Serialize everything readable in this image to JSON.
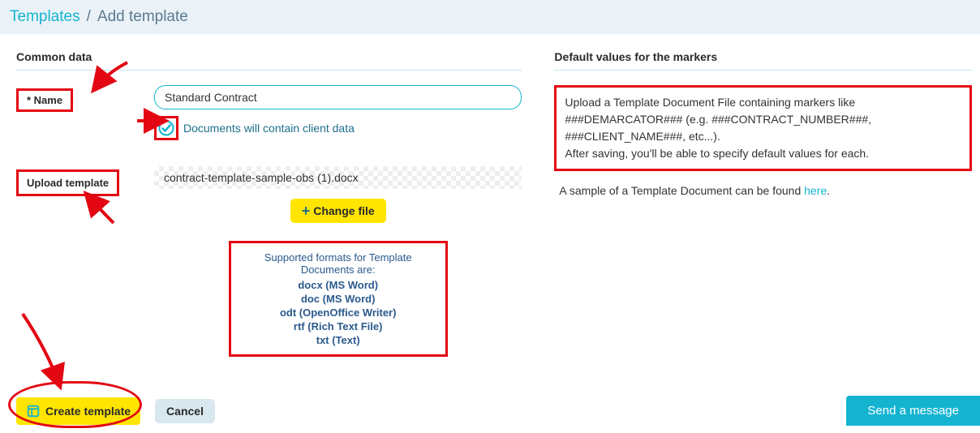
{
  "breadcrumb": {
    "templates": "Templates",
    "sep": "/",
    "current": "Add template"
  },
  "left": {
    "section_title": "Common data",
    "name_label": "* Name",
    "name_value": "Standard Contract",
    "clientdata_label": "Documents will contain client data",
    "upload_label": "Upload template",
    "filename": "contract-template-sample-obs (1).docx",
    "changefile_label": "Change file",
    "formats": {
      "intro": "Supported formats for Template Documents are:",
      "items": [
        "docx (MS Word)",
        "doc (MS Word)",
        "odt (OpenOffice Writer)",
        "rtf (Rich Text File)",
        "txt (Text)"
      ]
    },
    "create_label": "Create template",
    "cancel_label": "Cancel"
  },
  "right": {
    "section_title": "Default values for the markers",
    "info_line1": "Upload a Template Document File containing markers like ###DEMARCATOR### (e.g. ###CONTRACT_NUMBER###, ###CLIENT_NAME###, etc...).",
    "info_line2": "After saving, you'll be able to specify default values for each.",
    "sample_prefix": "A sample of a Template Document can be found ",
    "sample_link": "here",
    "sample_suffix": "."
  },
  "chat": {
    "label": "Send a message"
  }
}
